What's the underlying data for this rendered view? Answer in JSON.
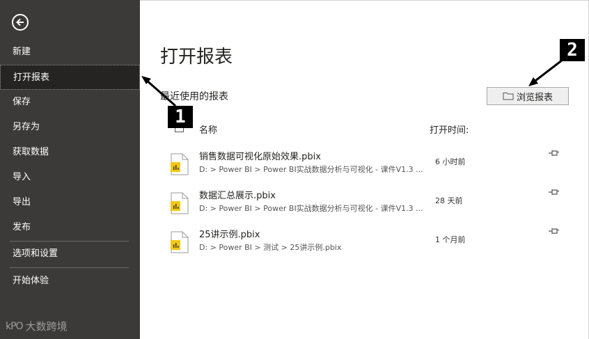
{
  "sidebar": {
    "items": [
      {
        "label": "新建"
      },
      {
        "label": "打开报表"
      },
      {
        "label": "保存"
      },
      {
        "label": "另存为"
      },
      {
        "label": "获取数据"
      },
      {
        "label": "导入"
      },
      {
        "label": "导出"
      },
      {
        "label": "发布"
      },
      {
        "label": "选项和设置"
      },
      {
        "label": "开始体验"
      }
    ],
    "watermark": {
      "logo": "kPO",
      "text": "大数跨境"
    }
  },
  "main": {
    "title": "打开报表",
    "recent_heading": "最近使用的报表",
    "browse_label": "浏览报表",
    "columns": {
      "name": "名称",
      "time": "打开时间:"
    },
    "files": [
      {
        "name": "销售数据可视化原始效果.pbix",
        "path": "D: > Power BI > Power BI实战数据分析与可视化 - 课件V1.3 ...",
        "time": "6 小时前"
      },
      {
        "name": "数据汇总展示.pbix",
        "path": "D: > Power BI > Power BI实战数据分析与可视化 - 课件V1.3 ...",
        "time": "28 天前"
      },
      {
        "name": "25讲示例.pbix",
        "path": "D: > Power BI > 测试 > 25讲示例.pbix",
        "time": "1 个月前"
      }
    ]
  },
  "annotations": {
    "badge_1": "1",
    "badge_2": "2"
  },
  "colors": {
    "sidebar_bg": "#3b3a39",
    "sidebar_active": "#252423",
    "file_icon_accent": "#f2c811"
  }
}
